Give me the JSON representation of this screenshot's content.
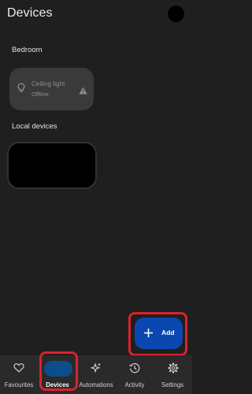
{
  "header": {
    "title": "Devices"
  },
  "sections": {
    "bedroom_label": "Bedroom",
    "local_label": "Local devices"
  },
  "bedroom_device": {
    "name": "Ceiling light",
    "status": "Offline",
    "icon": "lightbulb-icon",
    "status_icon": "warning-icon"
  },
  "fab": {
    "label": "Add",
    "icon": "plus-icon",
    "color": "#0b47b0"
  },
  "nav": {
    "items": [
      {
        "label": "Favourites",
        "icon": "heart-icon",
        "selected": false
      },
      {
        "label": "Devices",
        "icon": "devices-icon",
        "selected": true
      },
      {
        "label": "Automations",
        "icon": "sparkle-icon",
        "selected": false
      },
      {
        "label": "Activity",
        "icon": "history-icon",
        "selected": false
      },
      {
        "label": "Settings",
        "icon": "gear-icon",
        "selected": false
      }
    ]
  },
  "colors": {
    "background": "#1f1f1f",
    "card": "#3a3a3a",
    "highlight": "#d9232e",
    "nav_selected": "#0e4d8b"
  }
}
